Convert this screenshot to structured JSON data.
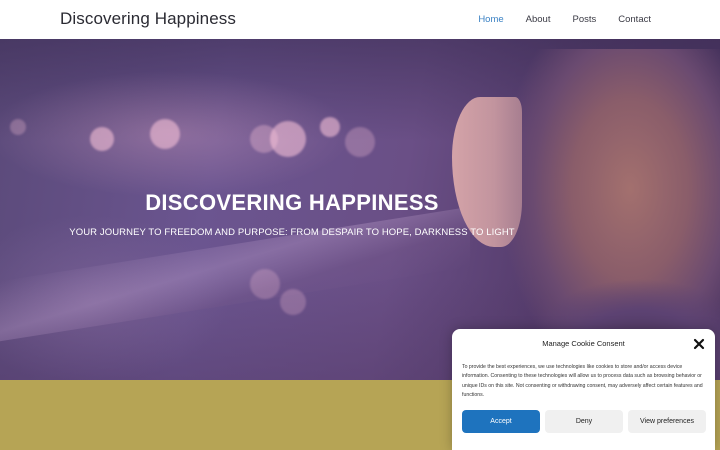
{
  "header": {
    "site_title": "Discovering Happiness",
    "nav": [
      {
        "label": "Home",
        "active": true
      },
      {
        "label": "About",
        "active": false
      },
      {
        "label": "Posts",
        "active": false
      },
      {
        "label": "Contact",
        "active": false
      }
    ]
  },
  "hero": {
    "title": "DISCOVERING HAPPINESS",
    "subtitle": "YOUR JOURNEY TO FREEDOM AND PURPOSE: FROM DESPAIR TO HOPE, DARKNESS TO LIGHT"
  },
  "cookie": {
    "title": "Manage Cookie Consent",
    "text": "To provide the best experiences, we use technologies like cookies to store and/or access device information. Consenting to these technologies will allow us to process data such as browsing behavior or unique IDs on this site. Not consenting or withdrawing consent, may adversely affect certain features and functions.",
    "accept_label": "Accept",
    "deny_label": "Deny",
    "prefs_label": "View preferences"
  },
  "colors": {
    "accent": "#1e73be",
    "nav_active": "#3b82c4",
    "band": "#b6a455",
    "hero_tint": "#6b5590"
  },
  "icons": {
    "close": "close-icon"
  }
}
